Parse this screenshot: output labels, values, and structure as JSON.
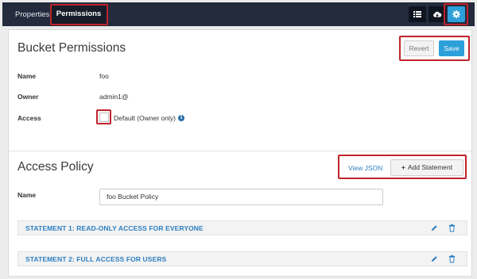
{
  "tabs": [
    {
      "label": "Properties",
      "active": false
    },
    {
      "label": "Permissions",
      "active": true
    }
  ],
  "toolbar_icons": [
    "list-icon",
    "cloud-icon",
    "gear-icon"
  ],
  "bucket_permissions": {
    "title": "Bucket Permissions",
    "revert_label": "Revert",
    "save_label": "Save",
    "fields": {
      "name_label": "Name",
      "name_value": "foo",
      "owner_label": "Owner",
      "owner_value": "admin1@",
      "access_label": "Access",
      "access_value": "Default (Owner only)"
    }
  },
  "access_policy": {
    "title": "Access Policy",
    "view_json_label": "View JSON",
    "add_statement_label": "Add Statement",
    "name_label": "Name",
    "name_value": "foo Bucket Policy",
    "statements": [
      {
        "title": "STATEMENT 1: READ-ONLY ACCESS FOR EVERYONE"
      },
      {
        "title": "STATEMENT 2: FULL ACCESS FOR USERS"
      }
    ]
  },
  "colors": {
    "topbar": "#232b3d",
    "accent": "#2d9fd9",
    "link": "#2d7fc2",
    "highlight": "#c0232b"
  }
}
